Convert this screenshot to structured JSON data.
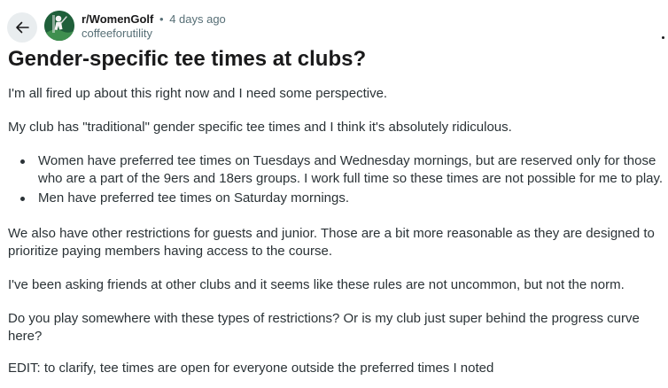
{
  "header": {
    "subreddit": "r/WomenGolf",
    "separator": "•",
    "time_ago": "4 days ago",
    "author": "coffeeforutility"
  },
  "post": {
    "title": "Gender-specific tee times at clubs?",
    "paragraph_1": "I'm all fired up about this right now and I need some perspective.",
    "paragraph_2": "My club has \"traditional\" gender specific tee times and I think it's absolutely ridiculous.",
    "bullets": [
      "Women have preferred tee times on Tuesdays and Wednesday mornings, but are reserved only for those who are a part of the 9ers and 18ers groups. I work full time so these times are not possible for me to play.",
      "Men have preferred tee times on Saturday mornings."
    ],
    "paragraph_3": "We also have other restrictions for guests and junior. Those are a bit more reasonable as they are designed to prioritize paying members having access to the course.",
    "paragraph_4": "I've been asking friends at other clubs and it seems like these rules are not uncommon, but not the norm.",
    "paragraph_5": "Do you play somewhere with these types of restrictions? Or is my club just super behind the progress curve here?",
    "paragraph_6": "EDIT: to clarify, tee times are open for everyone outside the preferred times I noted"
  },
  "icons": {
    "back": "arrow-left-icon",
    "avatar": "subreddit-avatar-golfer",
    "overflow": "overflow-menu-icon"
  },
  "colors": {
    "back_button_bg": "#e9edef",
    "meta_gray": "#576f76",
    "body_text": "#2a3236",
    "title_text": "#1a1a1b",
    "avatar_bg": "#1f5f3a"
  }
}
